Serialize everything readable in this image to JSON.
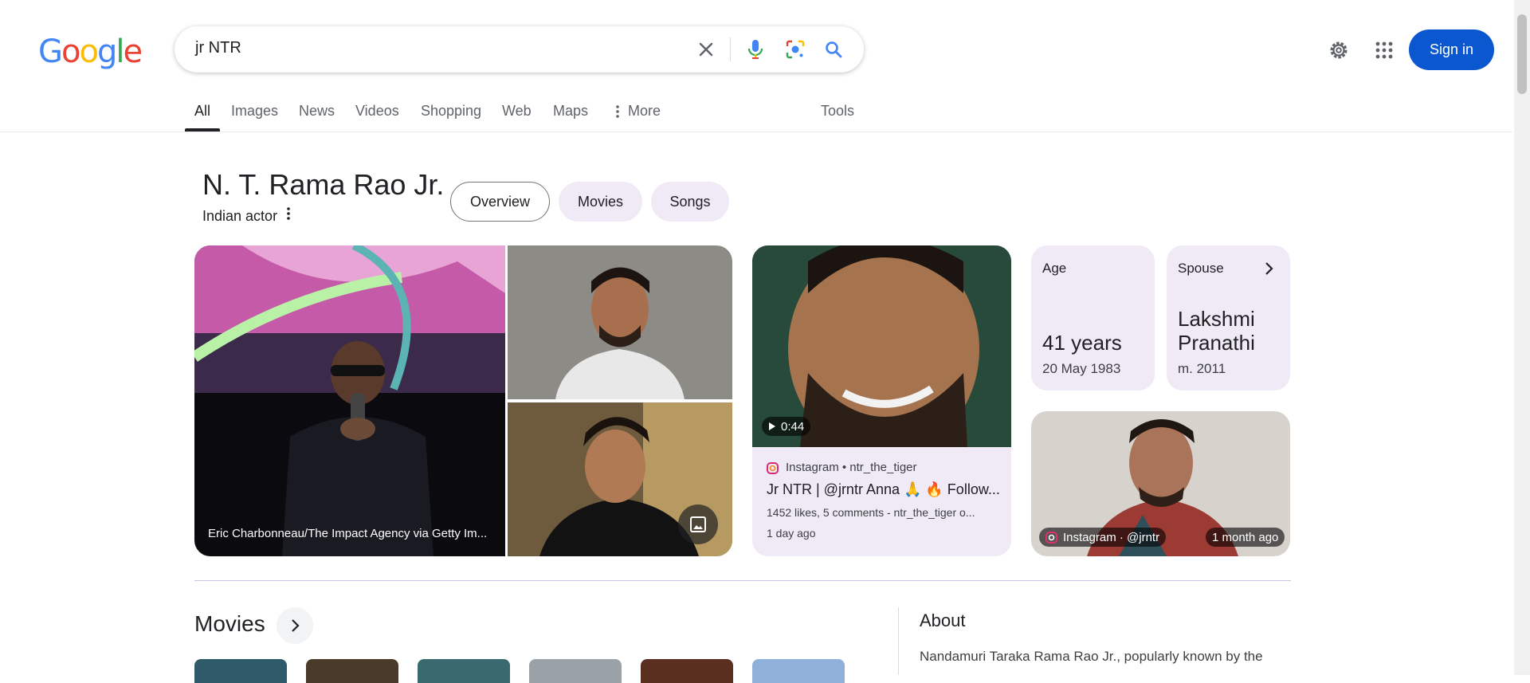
{
  "header": {
    "logo_letters": [
      "G",
      "o",
      "o",
      "g",
      "l",
      "e"
    ],
    "logo_colors": [
      "#4285F4",
      "#EA4335",
      "#FBBC05",
      "#4285F4",
      "#34A853",
      "#EA4335"
    ],
    "search_query": "jr NTR",
    "signin_label": "Sign in",
    "icons": [
      "clear-icon",
      "microphone-icon",
      "lens-icon",
      "search-icon",
      "settings-gear-icon",
      "apps-grid-icon"
    ]
  },
  "tabs": [
    "All",
    "Images",
    "News",
    "Videos",
    "Shopping",
    "Web",
    "Maps",
    "More",
    "Tools"
  ],
  "entity": {
    "title": "N. T. Rama Rao Jr.",
    "subtitle": "Indian actor",
    "chips": [
      "Overview",
      "Movies",
      "Songs"
    ]
  },
  "images": {
    "main_caption": "Eric Charbonneau/The Impact Agency via Getty Im...",
    "video_duration": "0:44"
  },
  "instagram_post": {
    "source": "Instagram • ntr_the_tiger",
    "title": "Jr NTR | @jrntr Anna 🙏 🔥 Follow...",
    "meta": "1452 likes, 5 comments - ntr_the_tiger o...",
    "time": "1 day ago"
  },
  "facts": {
    "age": {
      "label": "Age",
      "value": "41 years",
      "detail": "20 May 1983"
    },
    "spouse": {
      "label": "Spouse",
      "value_line1": "Lakshmi",
      "value_line2": "Pranathi",
      "detail": "m. 2011"
    }
  },
  "instagram_thumb": {
    "source": "Instagram · @jrntr",
    "time": "1 month ago"
  },
  "movies": {
    "heading": "Movies"
  },
  "about": {
    "heading": "About",
    "text": "Nandamuri Taraka Rama Rao Jr., popularly known by the"
  },
  "colors": {
    "accent": "#0b57d0",
    "chip_bg": "#f0eaf6"
  }
}
